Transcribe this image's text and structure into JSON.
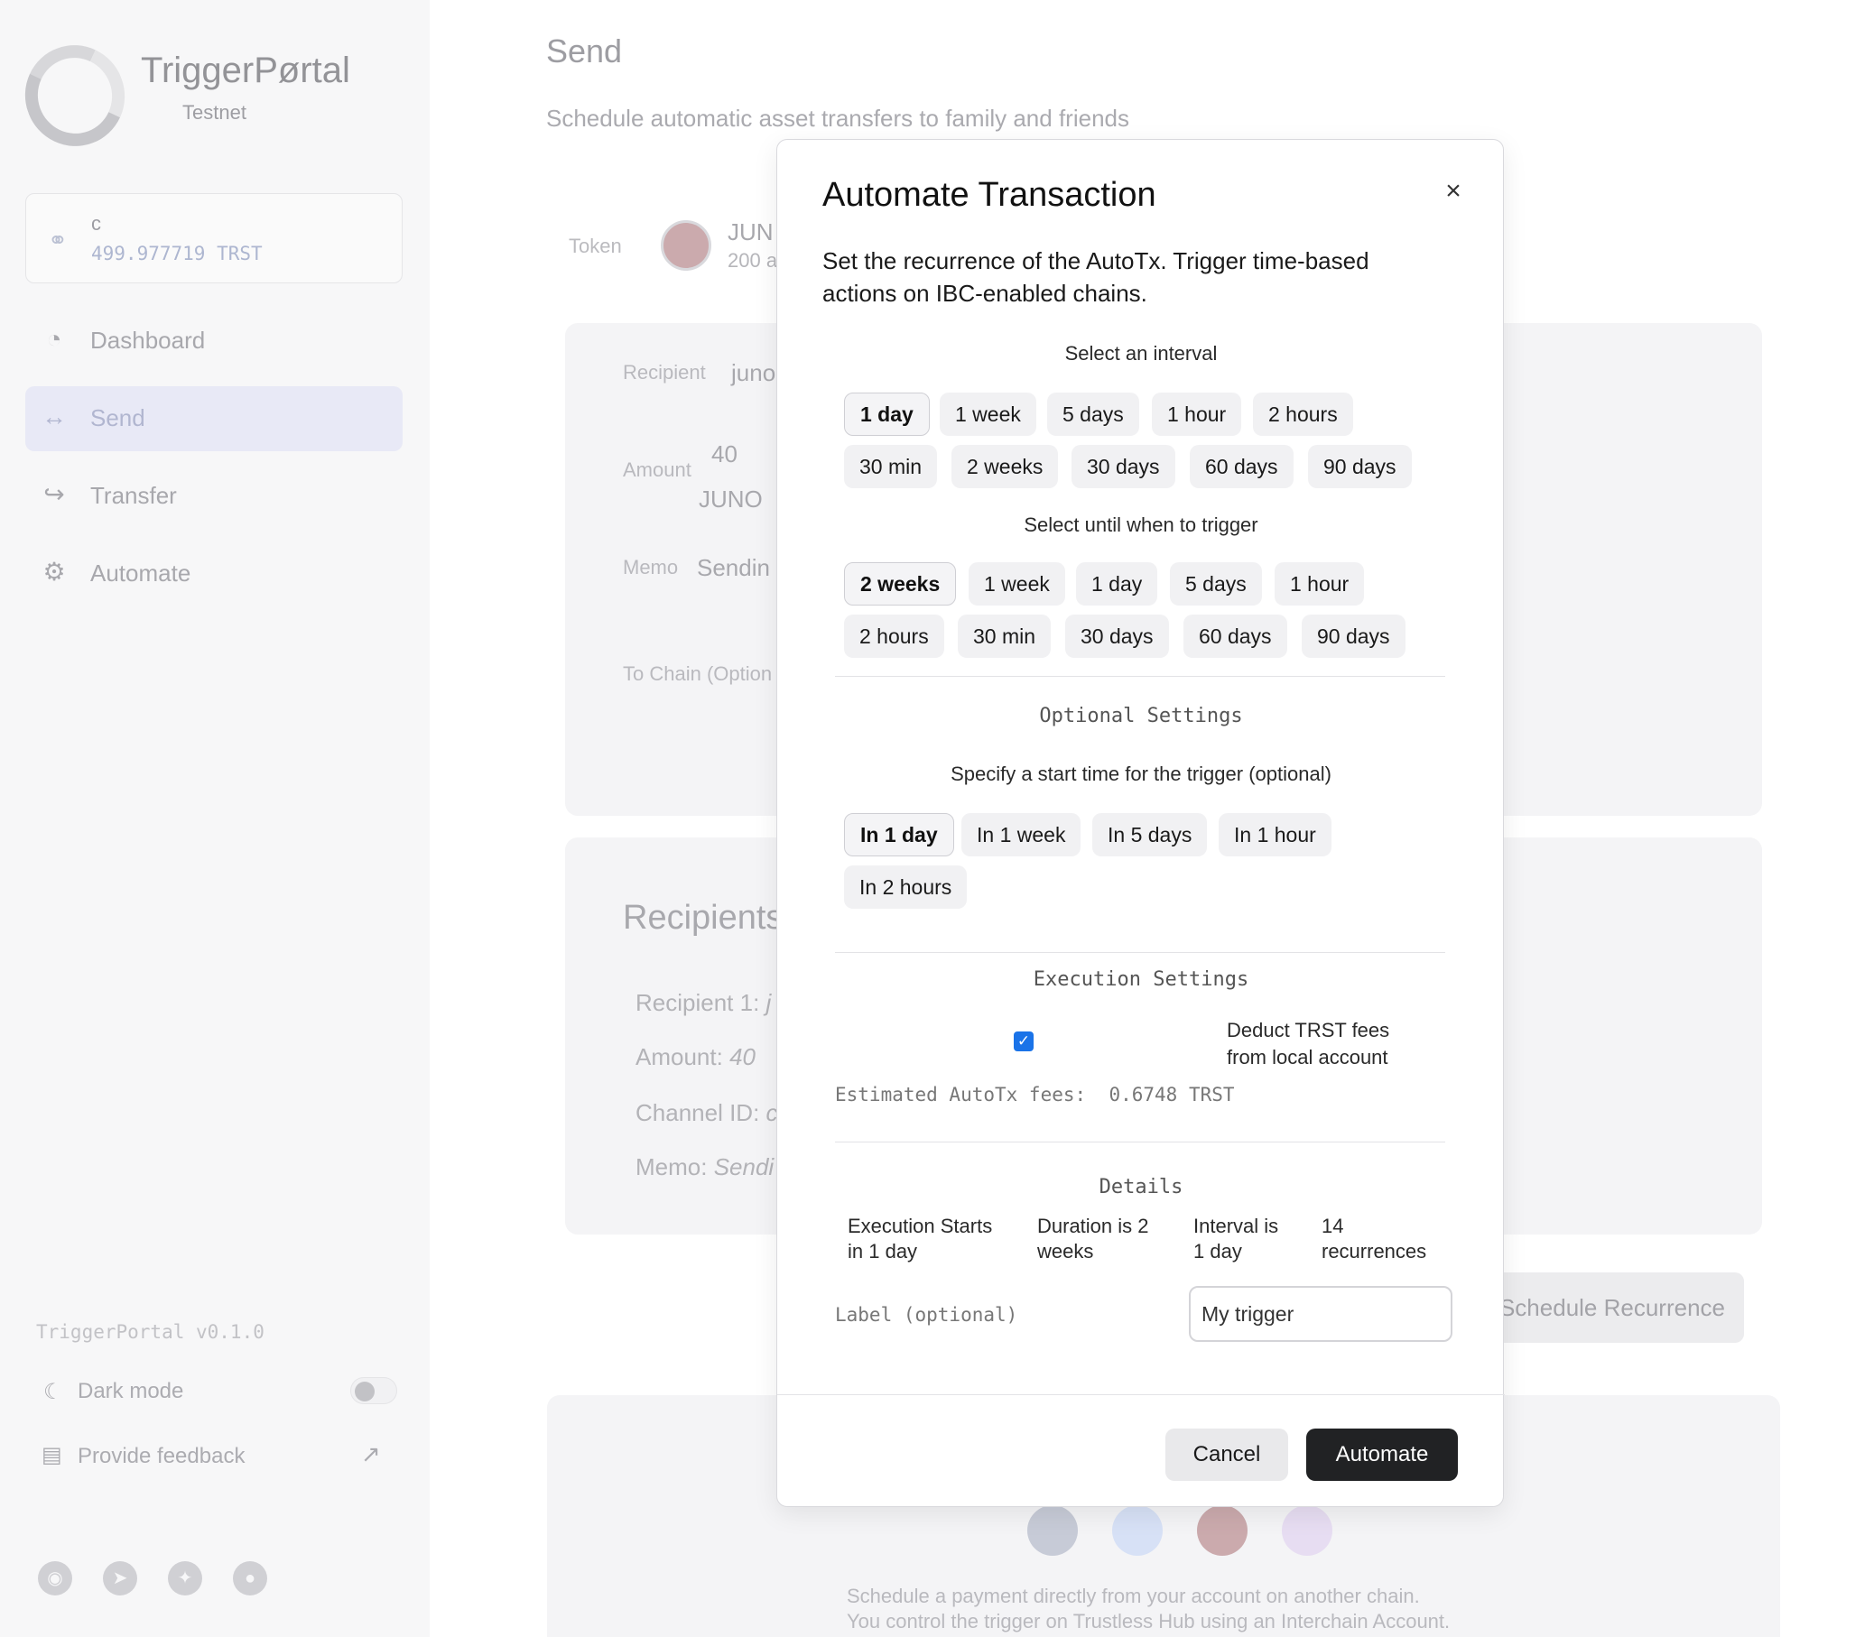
{
  "sidebar": {
    "brand": "TriggerPørtal",
    "network": "Testnet",
    "wallet": {
      "account": "c",
      "balance": "499.977719 TRST"
    },
    "nav": [
      {
        "label": "Dashboard",
        "icon": "clock-icon"
      },
      {
        "label": "Send",
        "icon": "arrows-horizontal-icon"
      },
      {
        "label": "Transfer",
        "icon": "share-arrow-icon"
      },
      {
        "label": "Automate",
        "icon": "gear-icon"
      }
    ],
    "version": "TriggerPortal v0.1.0",
    "dark_mode_label": "Dark mode",
    "feedback_label": "Provide feedback",
    "social": [
      "discord-icon",
      "telegram-icon",
      "twitter-icon",
      "github-icon"
    ]
  },
  "main": {
    "title": "Send",
    "subtitle": "Schedule automatic asset transfers to family and friends",
    "token_label": "Token",
    "token_name": "JUN",
    "token_amount": "200 a",
    "recipient_label": "Recipient",
    "recipient_value": "juno",
    "amount_label": "Amount",
    "amount_value": "40",
    "amount_denom": "JUNO",
    "memo_label": "Memo",
    "memo_value": "Sendin",
    "to_chain_label": "To Chain (Option",
    "recipients_title": "Recipients",
    "recipient_1_label": "Recipient 1:",
    "recipient_1_value": "j",
    "amount_line_label": "Amount:",
    "amount_line_value": "40",
    "channel_label": "Channel ID:",
    "channel_value": "c",
    "memo_line_label": "Memo:",
    "memo_line_value": "Sendi",
    "schedule_button": "Schedule Recurrence",
    "footer_line_1": "Schedule a payment directly from your account on another chain.",
    "footer_line_2": "You control the trigger on Trustless Hub using an Interchain Account."
  },
  "modal": {
    "title": "Automate Transaction",
    "close": "×",
    "description": "Set the recurrence of the AutoTx. Trigger time-based actions on IBC-enabled chains.",
    "interval_label": "Select an interval",
    "intervals": [
      "1 day",
      "1 week",
      "5 days",
      "1 hour",
      "2 hours",
      "30 min",
      "2 weeks",
      "30 days",
      "60 days",
      "90 days"
    ],
    "interval_selected": "1 day",
    "until_label": "Select until when to trigger",
    "untils": [
      "2 weeks",
      "1 week",
      "1 day",
      "5 days",
      "1 hour",
      "2 hours",
      "30 min",
      "30 days",
      "60 days",
      "90 days"
    ],
    "until_selected": "2 weeks",
    "optional_heading": "Optional Settings",
    "start_label": "Specify a start time for the trigger (optional)",
    "starts": [
      "In 1 day",
      "In 1 week",
      "In 5 days",
      "In 1 hour",
      "In 2 hours"
    ],
    "start_selected": "In 1 day",
    "execution_heading": "Execution Settings",
    "deduct_label": "Deduct TRST fees from local account",
    "deduct_checked": true,
    "fees_label": "Estimated AutoTx fees:",
    "fees_value": "0.6748 TRST",
    "details_heading": "Details",
    "details": [
      "Execution Starts in 1 day",
      "Duration is 2 weeks",
      "Interval is 1 day",
      "14 recurrences"
    ],
    "label_field_label": "Label (optional)",
    "label_field_value": "My trigger",
    "cancel": "Cancel",
    "automate": "Automate"
  },
  "colors": {
    "primary_button": "#212224",
    "checkbox": "#1a73e8",
    "active_nav": "#e8e9f6"
  }
}
